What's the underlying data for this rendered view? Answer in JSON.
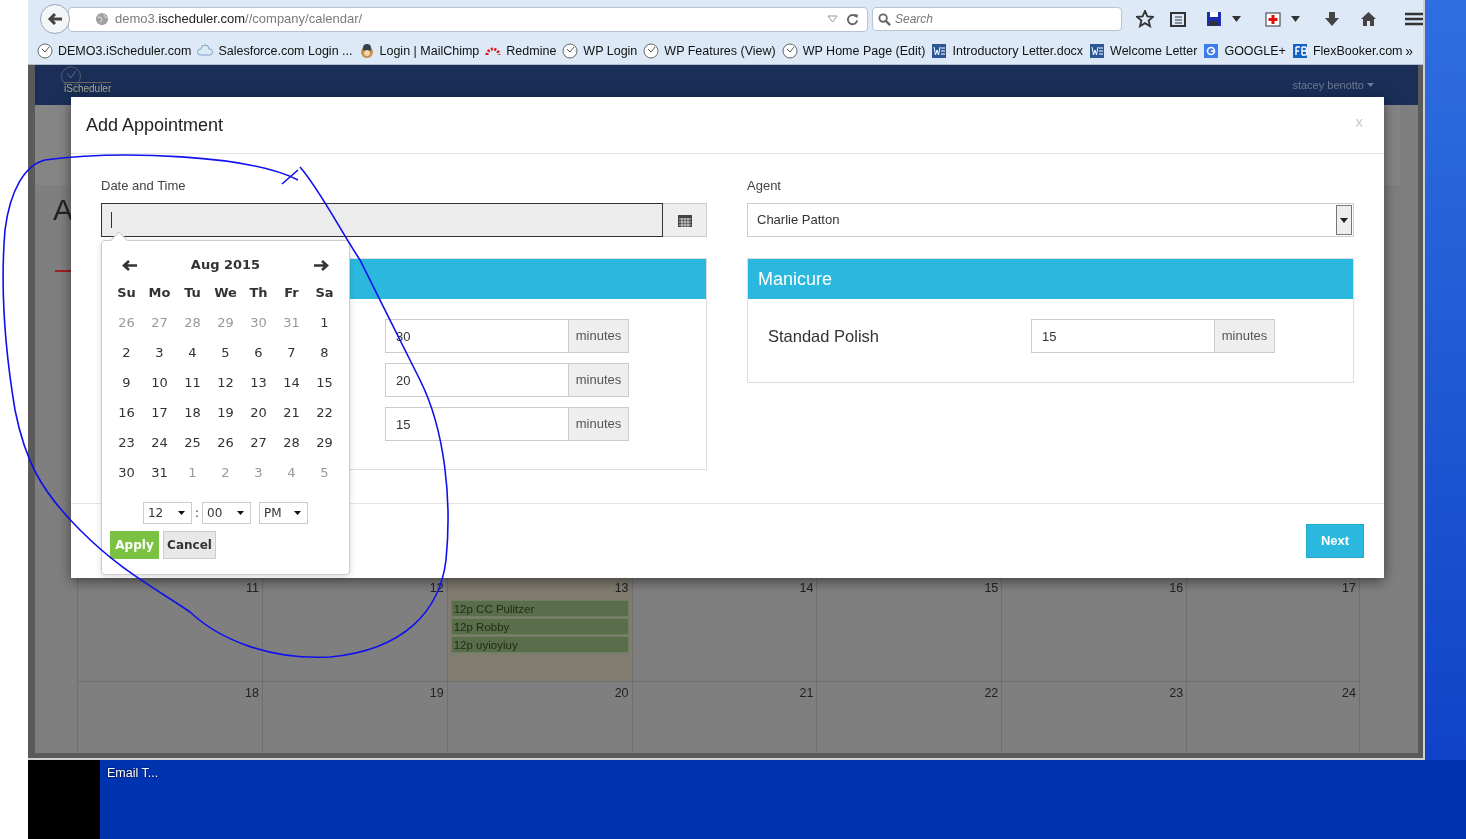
{
  "browser": {
    "url": "demo3.**ischeduler.com**//company/calendar/",
    "search_placeholder": "Search",
    "bookmarks": [
      {
        "label": "DEMO3.iScheduler.com",
        "kind": "clock"
      },
      {
        "label": "Salesforce.com Login ...",
        "kind": "cloud"
      },
      {
        "label": "Login | MailChimp",
        "kind": "chimp"
      },
      {
        "label": "Redmine",
        "kind": "gauge"
      },
      {
        "label": "WP Login",
        "kind": "clock"
      },
      {
        "label": "WP Features (View)",
        "kind": "clock"
      },
      {
        "label": "WP Home Page (Edit)",
        "kind": "clock"
      },
      {
        "label": "Introductory Letter.docx",
        "kind": "word"
      },
      {
        "label": "Welcome Letter",
        "kind": "word"
      },
      {
        "label": "GOOGLE+",
        "kind": "google"
      },
      {
        "label": "FlexBooker.com",
        "kind": "fb"
      }
    ],
    "overflow": "»"
  },
  "app_header": {
    "logo_text": "iScheduler",
    "user_menu": "stacey benotto"
  },
  "background_page": {
    "heading_fragment": "A",
    "calendar": {
      "weeks": [
        {
          "days": [
            {
              "number": "11",
              "today": false
            },
            {
              "number": "12",
              "today": false
            },
            {
              "number": "13",
              "today": true,
              "events": [
                "12p CC Pulitzer",
                "12p Robby",
                "12p uyioyiuy"
              ]
            },
            {
              "number": "14",
              "today": false
            },
            {
              "number": "15",
              "today": false
            },
            {
              "number": "16",
              "today": false
            },
            {
              "number": "17",
              "today": false
            }
          ]
        },
        {
          "days": [
            {
              "number": "18",
              "today": false
            },
            {
              "number": "19",
              "today": false
            },
            {
              "number": "20",
              "today": false
            },
            {
              "number": "21",
              "today": false
            },
            {
              "number": "22",
              "today": false
            },
            {
              "number": "23",
              "today": false
            },
            {
              "number": "24",
              "today": false
            }
          ]
        }
      ]
    }
  },
  "modal": {
    "title": "Add Appointment",
    "close": "x",
    "date_time": {
      "label": "Date and Time",
      "focused": true
    },
    "datepicker": {
      "month": "Aug 2015",
      "weekdays": [
        "Su",
        "Mo",
        "Tu",
        "We",
        "Th",
        "Fr",
        "Sa"
      ],
      "weeks": [
        [
          {
            "day": "26",
            "muted": true
          },
          {
            "day": "27",
            "muted": true
          },
          {
            "day": "28",
            "muted": true
          },
          {
            "day": "29",
            "muted": true
          },
          {
            "day": "30",
            "muted": true
          },
          {
            "day": "31",
            "muted": true
          },
          {
            "day": "1",
            "muted": false
          }
        ],
        [
          {
            "day": "2",
            "muted": false
          },
          {
            "day": "3",
            "muted": false
          },
          {
            "day": "4",
            "muted": false
          },
          {
            "day": "5",
            "muted": false
          },
          {
            "day": "6",
            "muted": false
          },
          {
            "day": "7",
            "muted": false
          },
          {
            "day": "8",
            "muted": false
          }
        ],
        [
          {
            "day": "9",
            "muted": false
          },
          {
            "day": "10",
            "muted": false
          },
          {
            "day": "11",
            "muted": false
          },
          {
            "day": "12",
            "muted": false
          },
          {
            "day": "13",
            "muted": false
          },
          {
            "day": "14",
            "muted": false
          },
          {
            "day": "15",
            "muted": false
          }
        ],
        [
          {
            "day": "16",
            "muted": false
          },
          {
            "day": "17",
            "muted": false
          },
          {
            "day": "18",
            "muted": false
          },
          {
            "day": "19",
            "muted": false
          },
          {
            "day": "20",
            "muted": false
          },
          {
            "day": "21",
            "muted": false
          },
          {
            "day": "22",
            "muted": false
          }
        ],
        [
          {
            "day": "23",
            "muted": false
          },
          {
            "day": "24",
            "muted": false
          },
          {
            "day": "25",
            "muted": false
          },
          {
            "day": "26",
            "muted": false
          },
          {
            "day": "27",
            "muted": false
          },
          {
            "day": "28",
            "muted": false
          },
          {
            "day": "29",
            "muted": false
          }
        ],
        [
          {
            "day": "30",
            "muted": false
          },
          {
            "day": "31",
            "muted": false
          },
          {
            "day": "1",
            "muted": true
          },
          {
            "day": "2",
            "muted": true
          },
          {
            "day": "3",
            "muted": true
          },
          {
            "day": "4",
            "muted": true
          },
          {
            "day": "5",
            "muted": true
          }
        ]
      ],
      "time": {
        "hour": "12",
        "separator": ":",
        "minute": "00",
        "period": "PM"
      },
      "apply": "Apply",
      "cancel": "Cancel"
    },
    "left_panel": {
      "services": [
        {
          "duration": "30",
          "unit": "minutes"
        },
        {
          "duration": "20",
          "unit": "minutes"
        },
        {
          "duration": "15",
          "unit": "minutes"
        }
      ]
    },
    "agent": {
      "label": "Agent",
      "value": "Charlie Patton"
    },
    "right_panel": {
      "title": "Manicure",
      "services": [
        {
          "name": "Standad Polish",
          "duration": "15",
          "unit": "minutes"
        }
      ]
    },
    "next": "Next"
  },
  "taskbar": {
    "items": [
      "Email T..."
    ]
  }
}
